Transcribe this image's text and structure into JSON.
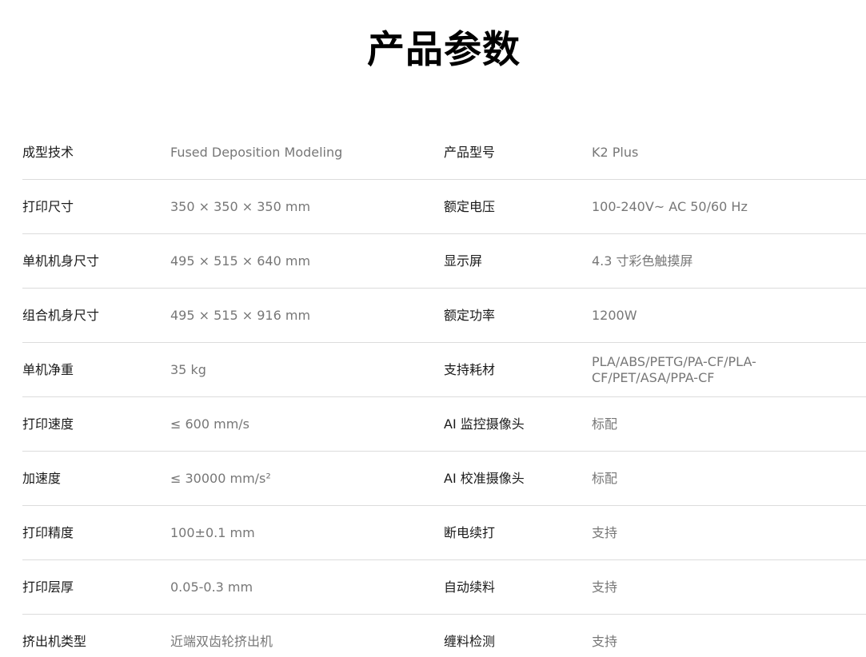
{
  "page": {
    "title": "产品参数"
  },
  "specs": [
    {
      "left_label": "成型技术",
      "left_value": "Fused Deposition Modeling",
      "right_label": "产品型号",
      "right_value": "K2 Plus"
    },
    {
      "left_label": "打印尺寸",
      "left_value": "350 × 350 × 350 mm",
      "right_label": "额定电压",
      "right_value": "100-240V~ AC 50/60 Hz"
    },
    {
      "left_label": "单机机身尺寸",
      "left_value": "495 × 515 × 640 mm",
      "right_label": "显示屏",
      "right_value": "4.3 寸彩色触摸屏"
    },
    {
      "left_label": "组合机身尺寸",
      "left_value": "495 × 515 × 916 mm",
      "right_label": "额定功率",
      "right_value": "1200W"
    },
    {
      "left_label": "单机净重",
      "left_value": "35 kg",
      "right_label": "支持耗材",
      "right_value": "PLA/ABS/PETG/PA-CF/PLA-CF/PET/ASA/PPA-CF"
    },
    {
      "left_label": "打印速度",
      "left_value": "≤ 600 mm/s",
      "right_label": "AI 监控摄像头",
      "right_value": "标配"
    },
    {
      "left_label": "加速度",
      "left_value": "≤ 30000 mm/s²",
      "right_label": "AI 校准摄像头",
      "right_value": "标配"
    },
    {
      "left_label": "打印精度",
      "left_value": "100±0.1 mm",
      "right_label": "断电续打",
      "right_value": "支持"
    },
    {
      "left_label": "打印层厚",
      "left_value": "0.05-0.3 mm",
      "right_label": "自动续料",
      "right_value": "支持"
    },
    {
      "left_label": "挤出机类型",
      "left_value": "近端双齿轮挤出机",
      "right_label": "缠料检测",
      "right_value": "支持"
    }
  ]
}
